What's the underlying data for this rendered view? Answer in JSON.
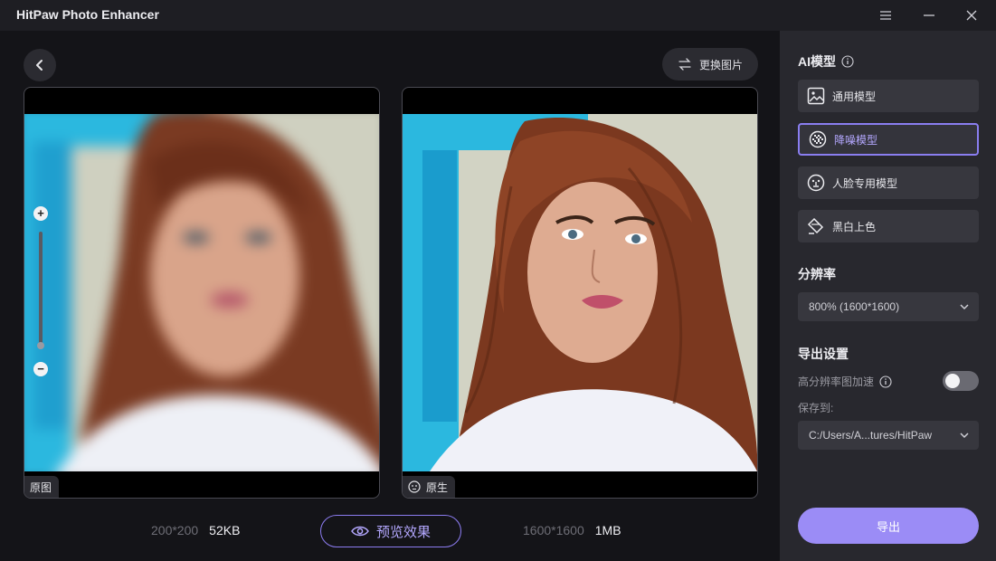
{
  "app": {
    "title": "HitPaw Photo Enhancer"
  },
  "window_controls": {
    "menu_icon": "menu-icon",
    "minimize_icon": "minimize-icon",
    "close_icon": "close-icon"
  },
  "toolbar": {
    "back_icon": "chevron-left-icon",
    "replace_label": "更换图片",
    "replace_icon": "swap-icon"
  },
  "panels": {
    "original": {
      "tag_label": "原图",
      "zoom_in": "+",
      "zoom_out": "−"
    },
    "enhanced": {
      "tag_label": "原生",
      "tag_icon": "face-icon"
    }
  },
  "stats": {
    "original": {
      "dimensions": "200*200",
      "size": "52KB"
    },
    "enhanced": {
      "dimensions": "1600*1600",
      "size": "1MB"
    }
  },
  "preview": {
    "label": "预览效果",
    "icon": "eye-icon"
  },
  "sidebar": {
    "ai_model_title": "AI模型",
    "models": [
      {
        "label": "通用模型",
        "icon": "image-icon",
        "selected": false
      },
      {
        "label": "降噪模型",
        "icon": "denoise-icon",
        "selected": true
      },
      {
        "label": "人脸专用模型",
        "icon": "face-icon",
        "selected": false
      },
      {
        "label": "黑白上色",
        "icon": "paint-bucket-icon",
        "selected": false
      }
    ],
    "resolution_title": "分辨率",
    "resolution_value": "800% (1600*1600)",
    "export_settings_title": "导出设置",
    "hi_res_accel_label": "高分辨率图加速",
    "hi_res_accel_enabled": false,
    "save_to_label": "保存到:",
    "save_path": "C:/Users/A...tures/HitPaw",
    "export_label": "导出"
  },
  "colors": {
    "accent": "#9b8cf6",
    "accent_border": "#8a7ef0",
    "panel_bg": "#28282e"
  }
}
